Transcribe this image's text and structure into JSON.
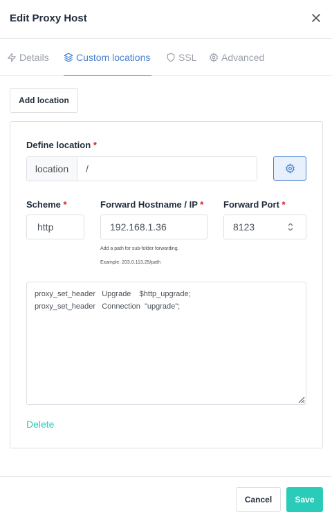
{
  "modal": {
    "title": "Edit Proxy Host"
  },
  "tabs": [
    {
      "label": "Details",
      "icon": "bolt-icon",
      "active": false
    },
    {
      "label": "Custom locations",
      "icon": "layers-icon",
      "active": true
    },
    {
      "label": "SSL",
      "icon": "shield-icon",
      "active": false
    },
    {
      "label": "Advanced",
      "icon": "gear-icon",
      "active": false
    }
  ],
  "add_location_label": "Add location",
  "location": {
    "define_label": "Define location",
    "required_mark": "*",
    "prefix": "location",
    "path_value": "/",
    "scheme_label": "Scheme",
    "scheme_value": "http",
    "hostname_label": "Forward Hostname / IP",
    "hostname_value": "192.168.1.36",
    "hostname_help": "Add a path for sub-folder forwarding.",
    "hostname_example": "Example: 203.0.113.25/path",
    "port_label": "Forward Port",
    "port_value": "8123",
    "config_lines": [
      "proxy_set_header   Upgrade    $http_upgrade;",
      "proxy_set_header   Connection  \"upgrade\";"
    ],
    "delete_label": "Delete"
  },
  "footer": {
    "cancel_label": "Cancel",
    "save_label": "Save"
  },
  "colors": {
    "accent_blue": "#467fcf",
    "teal": "#2bcbba",
    "required_red": "#cd201f",
    "muted_text": "#9aa0ac"
  }
}
